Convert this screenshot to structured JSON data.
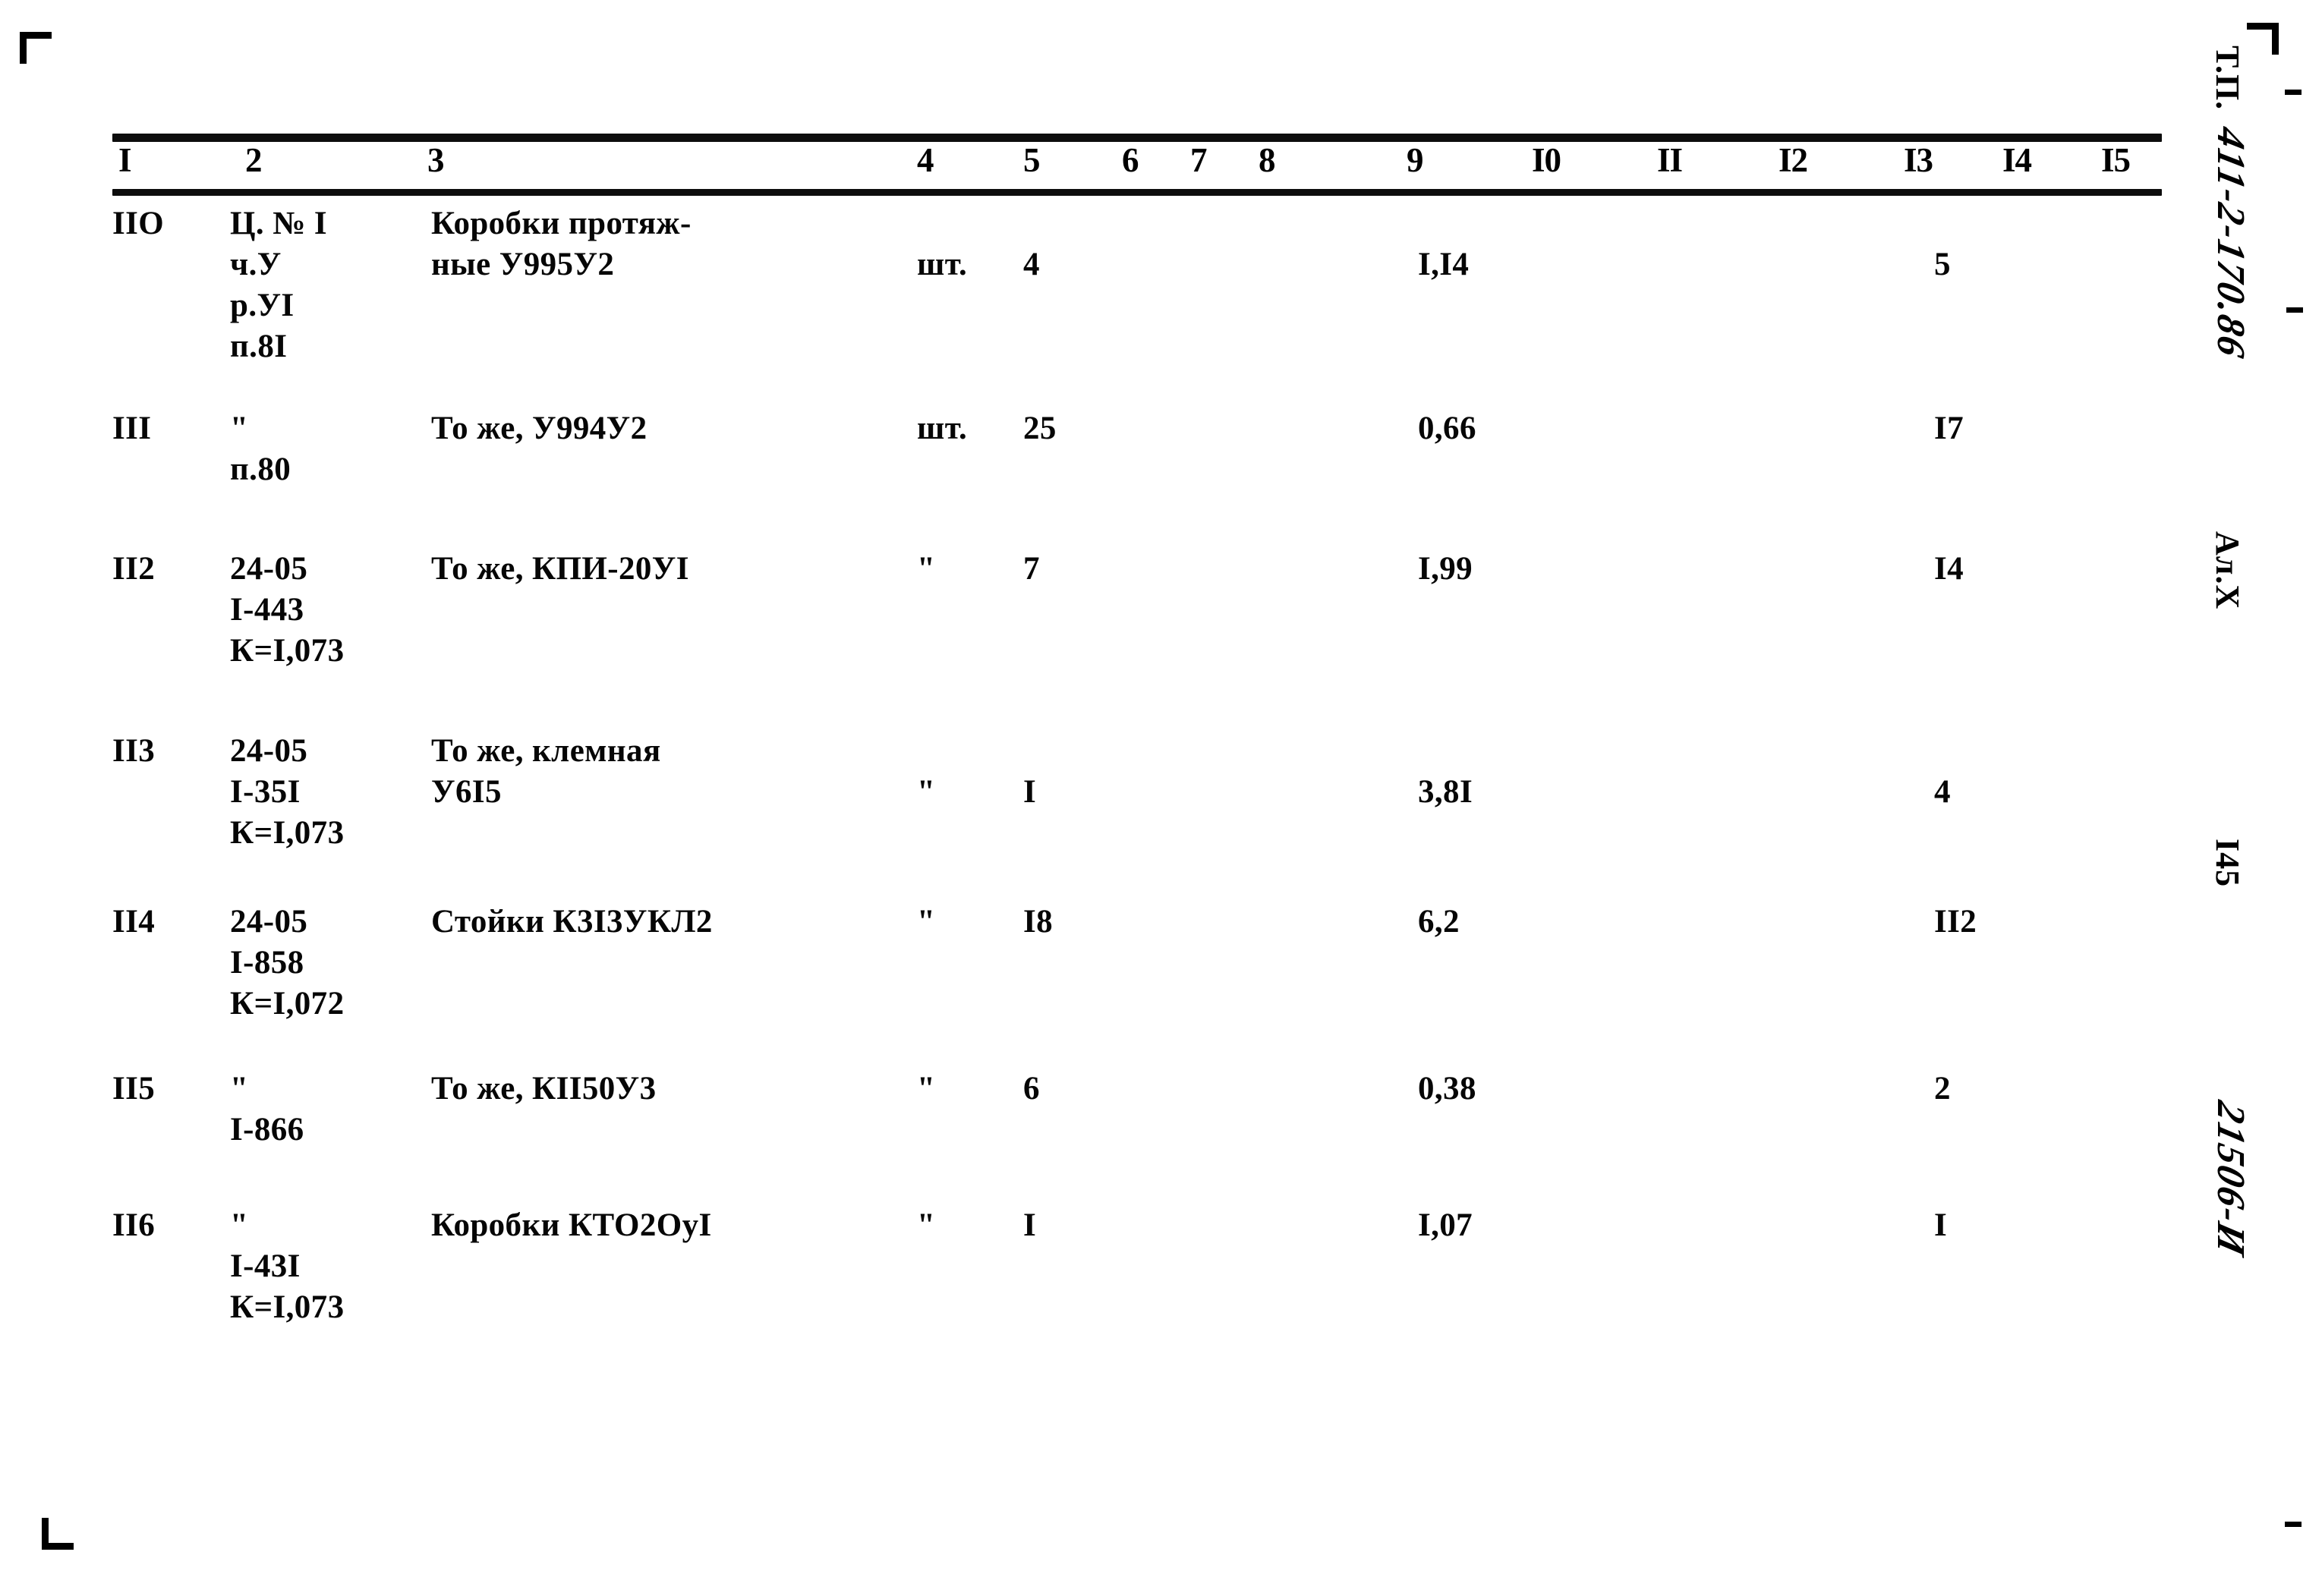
{
  "document": {
    "type_designation": "Т.П. 411-2-170.86",
    "album": "Ал.Х",
    "page_number": "I45",
    "order_stamp": "21506-И"
  },
  "table": {
    "column_numbers": [
      "I",
      "2",
      "3",
      "4",
      "5",
      "6",
      "7",
      "8",
      "9",
      "I0",
      "II",
      "I2",
      "I3",
      "I4",
      "I5"
    ],
    "rows": [
      {
        "position": "IIO",
        "justification": "Ц. № I\nч.У\nр.УI\nп.8I",
        "name": "Коробки протяж-\nные У995У2",
        "unit": "шт.",
        "quantity": "4",
        "mass": "I,I4",
        "total": "5"
      },
      {
        "position": "III",
        "justification": "\"\nп.80",
        "name": "То же, У994У2",
        "unit": "шт.",
        "quantity": "25",
        "mass": "0,66",
        "total": "I7"
      },
      {
        "position": "II2",
        "justification": "24-05\nI-443\nК=I,073",
        "name": "То же, КПИ-20УI",
        "unit": "\"",
        "quantity": "7",
        "mass": "I,99",
        "total": "I4"
      },
      {
        "position": "II3",
        "justification": "24-05\nI-35I\nК=I,073",
        "name": "То же, клемная\nУ6I5",
        "unit": "\"",
        "quantity": "I",
        "mass": "3,8I",
        "total": "4"
      },
      {
        "position": "II4",
        "justification": "24-05\nI-858\nК=I,072",
        "name": "Стойки К3I3УКЛ2",
        "unit": "\"",
        "quantity": "I8",
        "mass": "6,2",
        "total": "II2"
      },
      {
        "position": "II5",
        "justification": "\"\nI-866",
        "name": "То же, КII50У3",
        "unit": "\"",
        "quantity": "6",
        "mass": "0,38",
        "total": "2"
      },
      {
        "position": "II6",
        "justification": "\"\nI-43I\nК=I,073",
        "name": "Коробки КТО2ОуI",
        "unit": "\"",
        "quantity": "I",
        "mass": "I,07",
        "total": "I"
      }
    ]
  },
  "layout": {
    "column_number_x": [
      8,
      175,
      415,
      1060,
      1200,
      1330,
      1420,
      1510,
      1705,
      1870,
      2035,
      2195,
      2360,
      2490,
      2620
    ],
    "row_tops": [
      0,
      270,
      455,
      695,
      920,
      1140,
      1320
    ],
    "ink_color": "#060606"
  }
}
